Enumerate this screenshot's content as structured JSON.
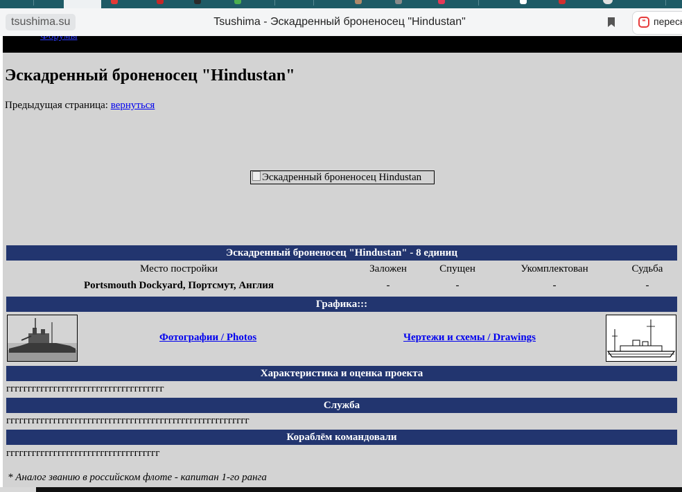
{
  "browser": {
    "domain": "tsushima.su",
    "page_title": "Tsushima - Эскадренный броненосец \"Hindustan\"",
    "search_text": "переск"
  },
  "nav": {
    "link_text": "Форумы"
  },
  "heading": "Эскадренный броненосец \"Hindustan\"",
  "prev": {
    "label": "Предыдущая страница:",
    "link": "вернуться"
  },
  "main_image_alt": "Эскадренный броненосец Hindustan",
  "table": {
    "title": "Эскадренный броненосец \"Hindustan\" - 8 единиц",
    "columns": [
      "Место постройки",
      "Заложен",
      "Спущен",
      "Укомплектован",
      "Судьба"
    ],
    "row": [
      "Portsmouth Dockyard, Портсмут, Англия",
      "-",
      "-",
      "-",
      "-"
    ]
  },
  "graphics": {
    "title": "Графика:::",
    "photos_link": "Фотографии / Photos",
    "drawings_link": "Чертежи и схемы / Drawings"
  },
  "sections": {
    "characteristics": {
      "title": "Характеристика и оценка проекта",
      "text": "ггггггггггггггггггггггггггггггггггггг"
    },
    "service": {
      "title": "Служба",
      "text": "ггггггггггггггггггггггггггггггггггггггггггггггггггггггггг"
    },
    "commanders": {
      "title": "Кораблём командовали",
      "text": "гггггггггггггггггггггггггггггггггггг"
    }
  },
  "footnote": "* Аналог званию в российском флоте - капитан 1-го ранга"
}
